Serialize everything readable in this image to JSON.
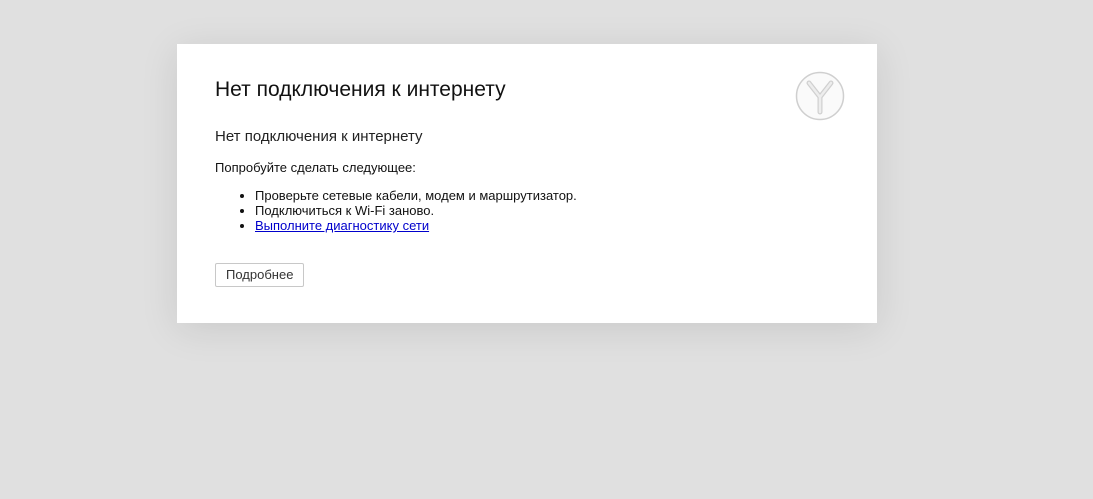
{
  "page": {
    "title": "Нет подключения к интернету",
    "subtitle": "Нет подключения к интернету",
    "intro": "Попробуйте сделать следующее:",
    "suggestions": [
      "Проверьте сетевые кабели, модем и маршрутизатор.",
      "Подключиться к Wi-Fi заново.",
      "Выполните диагностику сети"
    ],
    "details_button": "Подробнее",
    "logo_icon": "yandex-browser-logo-icon"
  },
  "colors": {
    "background": "#e0e0e0",
    "card": "#ffffff",
    "link": "#0000cc",
    "logo_stroke": "#c8c8c8"
  }
}
